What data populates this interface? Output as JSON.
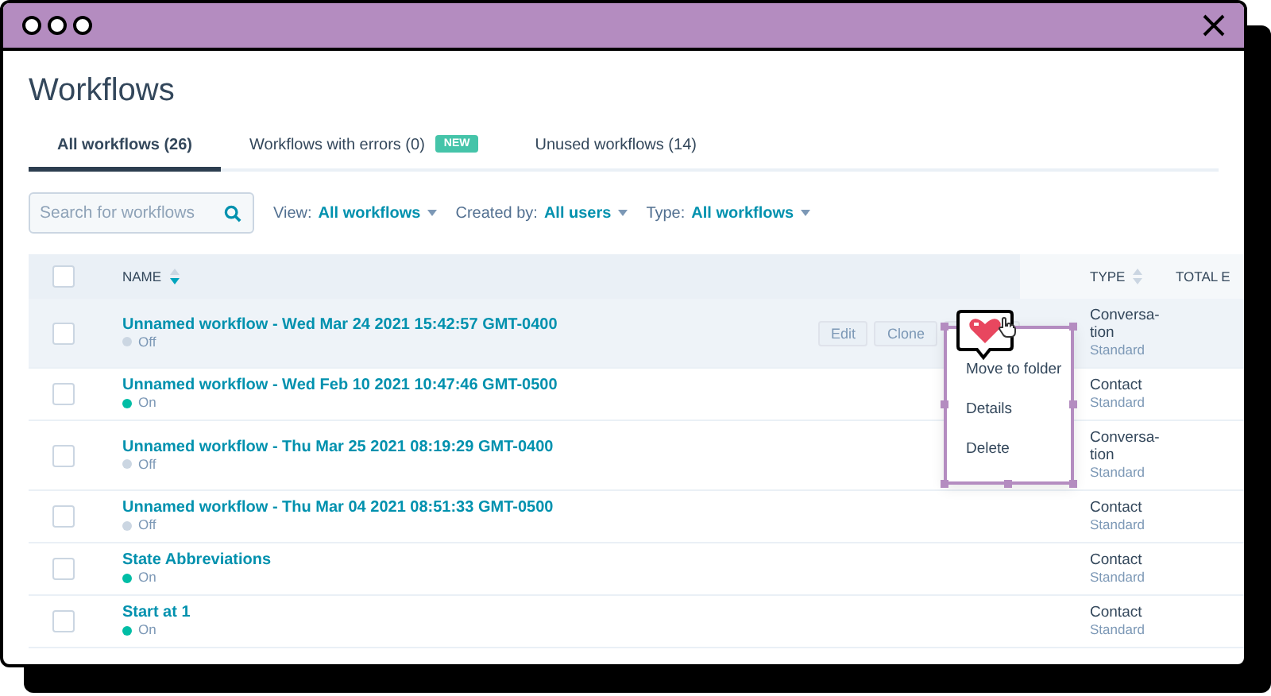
{
  "page": {
    "title": "Workflows"
  },
  "tabs": [
    {
      "label": "All workflows (26)",
      "selected": true
    },
    {
      "label": "Workflows with errors (0)",
      "selected": false,
      "badge": "NEW"
    },
    {
      "label": "Unused workflows (14)",
      "selected": false
    }
  ],
  "search": {
    "placeholder": "Search for workflows"
  },
  "filters": [
    {
      "label": "View:",
      "value": "All workflows"
    },
    {
      "label": "Created by:",
      "value": "All users"
    },
    {
      "label": "Type:",
      "value": "All workflows"
    }
  ],
  "table": {
    "columns": [
      {
        "label": "NAME",
        "sorted": true
      },
      {
        "label": "TYPE",
        "sorted": false
      },
      {
        "label": "TOTAL E"
      }
    ],
    "all_checked": false,
    "rows": [
      {
        "name": "Unnamed workflow - Wed Mar 24 2021 15:42:57 GMT-0400",
        "status": "Off",
        "on": false,
        "type": "Conversa-tion",
        "subtype": "Standard",
        "checked": false,
        "hovered": true,
        "actions": [
          "Edit",
          "Clone"
        ]
      },
      {
        "name": "Unnamed workflow - Wed Feb 10 2021 10:47:46 GMT-0500",
        "status": "On",
        "on": true,
        "type": "Contact",
        "subtype": "Standard",
        "checked": false,
        "hovered": false
      },
      {
        "name": "Unnamed workflow - Thu Mar 25 2021 08:19:29 GMT-0400",
        "status": "Off",
        "on": false,
        "type": "Conversa-tion",
        "subtype": "Standard",
        "checked": false,
        "hovered": false
      },
      {
        "name": "Unnamed workflow - Thu Mar 04 2021 08:51:33 GMT-0500",
        "status": "Off",
        "on": false,
        "type": "Contact",
        "subtype": "Standard",
        "checked": false,
        "hovered": false
      },
      {
        "name": "State Abbreviations",
        "status": "On",
        "on": true,
        "type": "Contact",
        "subtype": "Standard",
        "checked": false,
        "hovered": false
      },
      {
        "name": "Start at 1",
        "status": "On",
        "on": true,
        "type": "Contact",
        "subtype": "Standard",
        "checked": false,
        "hovered": false
      }
    ]
  },
  "context_menu": {
    "items": [
      "Move to folder",
      "Details",
      "Delete"
    ]
  }
}
